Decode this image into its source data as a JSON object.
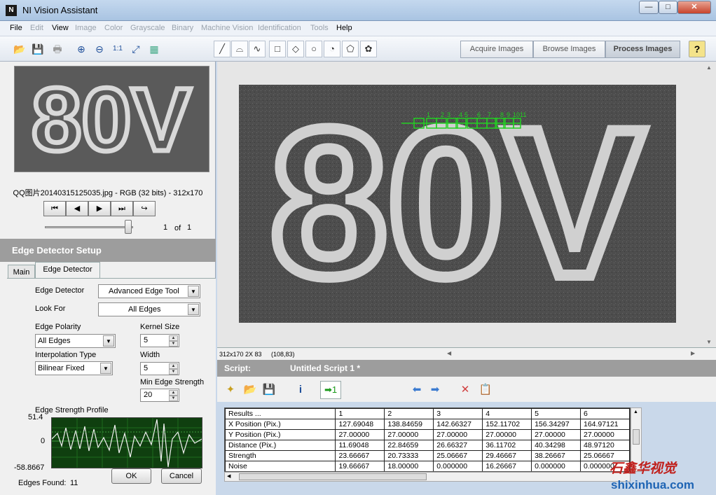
{
  "window": {
    "title": "NI Vision Assistant",
    "minimize": "—",
    "maximize": "□",
    "close": "✕"
  },
  "menu": [
    {
      "label": "File",
      "enabled": true
    },
    {
      "label": "Edit",
      "enabled": false
    },
    {
      "label": "View",
      "enabled": true
    },
    {
      "label": "Image",
      "enabled": false
    },
    {
      "label": "Color",
      "enabled": false
    },
    {
      "label": "Grayscale",
      "enabled": false
    },
    {
      "label": "Binary",
      "enabled": false
    },
    {
      "label": "Machine Vision",
      "enabled": false
    },
    {
      "label": "Identification",
      "enabled": false
    },
    {
      "label": "Tools",
      "enabled": false
    },
    {
      "label": "Help",
      "enabled": true
    }
  ],
  "modes": {
    "acquire": "Acquire Images",
    "browse": "Browse Images",
    "process": "Process Images",
    "help": "?"
  },
  "browser": {
    "thumb_text": "80V",
    "filename": "QQ图片20140315125035.jpg - RGB (32 bits) - 312x170",
    "nav": [
      "⏮",
      "◀",
      "▶",
      "⏭",
      "↪"
    ],
    "page_current": "1",
    "page_of": "of",
    "page_total": "1"
  },
  "setup": {
    "header": "Edge Detector Setup",
    "tabs": [
      "Main",
      "Edge Detector"
    ],
    "edge_detector_label": "Edge Detector",
    "edge_detector_value": "Advanced Edge Tool",
    "look_for_label": "Look For",
    "look_for_value": "All Edges",
    "polarity_label": "Edge Polarity",
    "polarity_value": "All Edges",
    "interp_label": "Interpolation Type",
    "interp_value": "Bilinear Fixed",
    "kernel_label": "Kernel Size",
    "kernel_value": "5",
    "width_label": "Width",
    "width_value": "5",
    "min_strength_label": "Min Edge Strength",
    "min_strength_value": "20",
    "profile_label": "Edge Strength Profile",
    "profile_ymax": "51.4",
    "profile_yzero": "0",
    "profile_ymin": "-58.8667",
    "edges_found_label": "Edges Found:",
    "edges_found_value": "11",
    "ok": "OK",
    "cancel": "Cancel"
  },
  "viewer": {
    "image_text": "80V",
    "edge_labels": [
      "1",
      "2",
      "3",
      "4",
      "5",
      "6",
      "7",
      "8",
      "9",
      "10",
      "11"
    ],
    "status_size": "312x170 2X 83",
    "status_coords": "(108,83)"
  },
  "script": {
    "label": "Script:",
    "title": "Untitled Script 1 *",
    "columns": [
      "Results ...",
      "1",
      "2",
      "3",
      "4",
      "5",
      "6"
    ],
    "rows": [
      [
        "X Position (Pix.)",
        "127.69048",
        "138.84659",
        "142.66327",
        "152.11702",
        "156.34297",
        "164.97121"
      ],
      [
        "Y Position (Pix.)",
        "27.00000",
        "27.00000",
        "27.00000",
        "27.00000",
        "27.00000",
        "27.00000"
      ],
      [
        "Distance (Pix.)",
        "11.69048",
        "22.84659",
        "26.66327",
        "36.11702",
        "40.34298",
        "48.97120"
      ],
      [
        "Strength",
        "23.66667",
        "20.73333",
        "25.06667",
        "29.46667",
        "38.26667",
        "25.06667"
      ],
      [
        "Noise",
        "19.66667",
        "18.00000",
        "0.000000",
        "16.26667",
        "0.000000",
        "0.000000"
      ]
    ]
  },
  "watermark": {
    "brand": "石鑫华视觉",
    "url": "shixinhua.com"
  }
}
